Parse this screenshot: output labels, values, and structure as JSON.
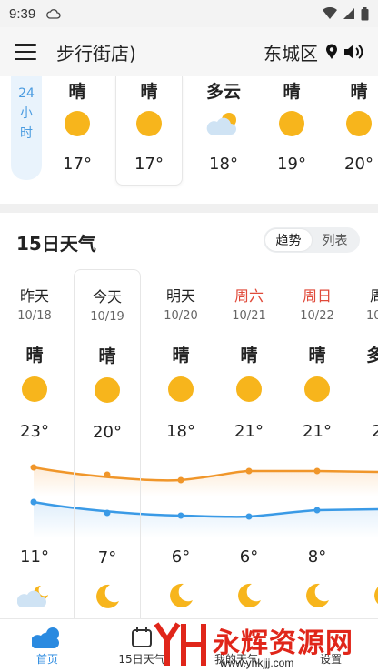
{
  "status": {
    "time": "9:39"
  },
  "header": {
    "location": "步行街店)",
    "district": "东城区"
  },
  "hourly": {
    "tag": "24\n小时",
    "tag_lines": [
      "24",
      "小",
      "时"
    ],
    "items": [
      {
        "cond": "晴",
        "temp": "17°",
        "icon": "sun-icon"
      },
      {
        "cond": "晴",
        "temp": "17°",
        "icon": "sun-icon"
      },
      {
        "cond": "多云",
        "temp": "18°",
        "icon": "partly-cloudy-icon"
      },
      {
        "cond": "晴",
        "temp": "19°",
        "icon": "sun-icon"
      },
      {
        "cond": "晴",
        "temp": "20°",
        "icon": "sun-icon"
      }
    ]
  },
  "daily": {
    "title": "15日天气",
    "toggle": {
      "trend": "趋势",
      "list": "列表"
    },
    "days": [
      {
        "name": "昨天",
        "date": "10/18",
        "cond": "晴",
        "high": "23°",
        "low": "11°",
        "weekend": false,
        "night_icon": "partly-cloudy-night-icon"
      },
      {
        "name": "今天",
        "date": "10/19",
        "cond": "晴",
        "high": "20°",
        "low": "7°",
        "weekend": false,
        "night_icon": "moon-icon"
      },
      {
        "name": "明天",
        "date": "10/20",
        "cond": "晴",
        "high": "18°",
        "low": "6°",
        "weekend": false,
        "night_icon": "moon-icon"
      },
      {
        "name": "周六",
        "date": "10/21",
        "cond": "晴",
        "high": "21°",
        "low": "6°",
        "weekend": true,
        "night_icon": "moon-icon"
      },
      {
        "name": "周日",
        "date": "10/22",
        "cond": "晴",
        "high": "21°",
        "low": "8°",
        "weekend": true,
        "night_icon": "moon-icon"
      },
      {
        "name": "周",
        "date": "10",
        "cond": "多",
        "high": "2",
        "low": "",
        "weekend": false,
        "night_icon": "moon-icon"
      }
    ]
  },
  "nav": [
    {
      "label": "首页",
      "icon": "home-weather-icon",
      "active": true
    },
    {
      "label": "15日天气",
      "icon": "calendar-icon",
      "active": false
    },
    {
      "label": "我的天气",
      "icon": "",
      "active": false
    },
    {
      "label": "设置",
      "icon": "",
      "active": false
    }
  ],
  "watermark": {
    "text": "永辉资源网",
    "url": "www.yhkjjj.com"
  },
  "colors": {
    "accent": "#2a8ae0",
    "high_line": "#f0962a",
    "low_line": "#3a9ae6",
    "weekend": "#e04a3a",
    "sun": "#f7b51c"
  }
}
